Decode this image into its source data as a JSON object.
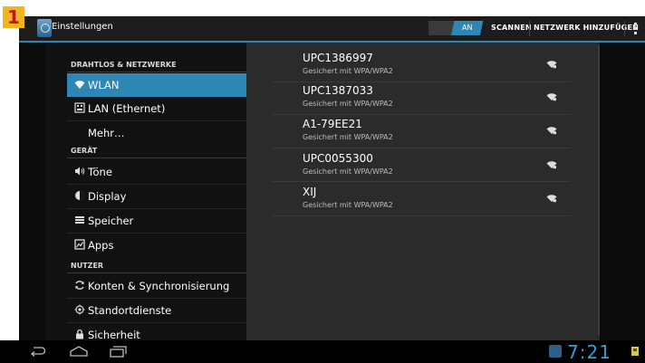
{
  "marker": "1",
  "actionbar": {
    "title": "Einstellungen",
    "toggle_label": "AN",
    "scan_label": "SCANNEN",
    "add_network_label": "NETZWERK HINZUFÜGEN"
  },
  "sidebar": {
    "sections": [
      {
        "header": "DRAHTLOS & NETZWERKE"
      },
      {
        "header": "GERÄT"
      },
      {
        "header": "NUTZER"
      }
    ],
    "items": [
      {
        "label": "WLAN",
        "icon": "wifi-icon",
        "selected": true
      },
      {
        "label": "LAN (Ethernet)",
        "icon": "ethernet-icon"
      },
      {
        "label": "Mehr…",
        "icon": ""
      },
      {
        "label": "Töne",
        "icon": "speaker-icon"
      },
      {
        "label": "Display",
        "icon": "brightness-icon"
      },
      {
        "label": "Speicher",
        "icon": "storage-icon"
      },
      {
        "label": "Apps",
        "icon": "apps-icon"
      },
      {
        "label": "Konten & Synchronisierung",
        "icon": "sync-icon"
      },
      {
        "label": "Standortdienste",
        "icon": "location-icon"
      },
      {
        "label": "Sicherheit",
        "icon": "lock-icon"
      }
    ]
  },
  "networks": [
    {
      "ssid": "UPC1386997",
      "security": "Gesichert mit WPA/WPA2"
    },
    {
      "ssid": "UPC1387033",
      "security": "Gesichert mit WPA/WPA2"
    },
    {
      "ssid": "A1-79EE21",
      "security": "Gesichert mit WPA/WPA2"
    },
    {
      "ssid": "UPC0055300",
      "security": "Gesichert mit WPA/WPA2"
    },
    {
      "ssid": "XIJ",
      "security": "Gesichert mit WPA/WPA2"
    }
  ],
  "statusbar": {
    "time": "7:21"
  },
  "colors": {
    "accent": "#2d86b4",
    "clock": "#2d9fd9",
    "marker_bg": "#f3b51d",
    "marker_text": "#c0141c"
  }
}
